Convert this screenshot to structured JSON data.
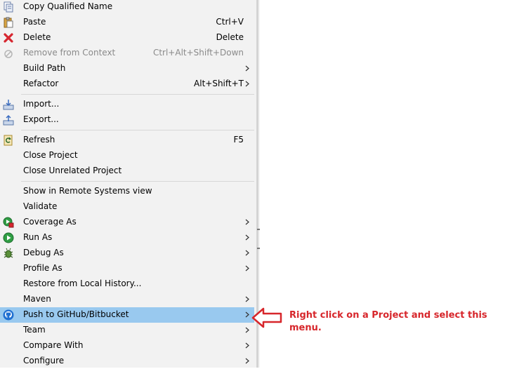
{
  "menu": {
    "items": [
      {
        "label": "Copy Qualified Name",
        "shortcut": "",
        "icon": "copy-qualified-name-icon"
      },
      {
        "label": "Paste",
        "shortcut": "Ctrl+V",
        "icon": "paste-icon"
      },
      {
        "label": "Delete",
        "shortcut": "Delete",
        "icon": "delete-icon"
      },
      {
        "label": "Remove from Context",
        "shortcut": "Ctrl+Alt+Shift+Down",
        "icon": "remove-context-icon",
        "disabled": true
      },
      {
        "label": "Build Path",
        "shortcut": "",
        "submenu": true
      },
      {
        "label": "Refactor",
        "shortcut": "Alt+Shift+T",
        "submenu": true
      },
      {
        "label": "Import...",
        "icon": "import-icon"
      },
      {
        "label": "Export...",
        "icon": "export-icon"
      },
      {
        "label": "Refresh",
        "shortcut": "F5",
        "icon": "refresh-icon"
      },
      {
        "label": "Close Project"
      },
      {
        "label": "Close Unrelated Project"
      },
      {
        "label": "Show in Remote Systems view"
      },
      {
        "label": "Validate"
      },
      {
        "label": "Coverage As",
        "submenu": true,
        "icon": "coverage-icon"
      },
      {
        "label": "Run As",
        "submenu": true,
        "icon": "run-icon"
      },
      {
        "label": "Debug As",
        "submenu": true,
        "icon": "debug-icon"
      },
      {
        "label": "Profile As",
        "submenu": true
      },
      {
        "label": "Restore from Local History..."
      },
      {
        "label": "Maven",
        "submenu": true
      },
      {
        "label": "Push to GitHub/Bitbucket",
        "submenu": true,
        "icon": "github-icon",
        "highlighted": true
      },
      {
        "label": "Team",
        "submenu": true
      },
      {
        "label": "Compare With",
        "submenu": true
      },
      {
        "label": "Configure",
        "submenu": true
      }
    ]
  },
  "annotation": {
    "text": "Right click on a Project and select this menu.",
    "color": "#d7262b"
  },
  "colors": {
    "menu_bg": "#f2f2f2",
    "highlight": "#99c9ef"
  }
}
